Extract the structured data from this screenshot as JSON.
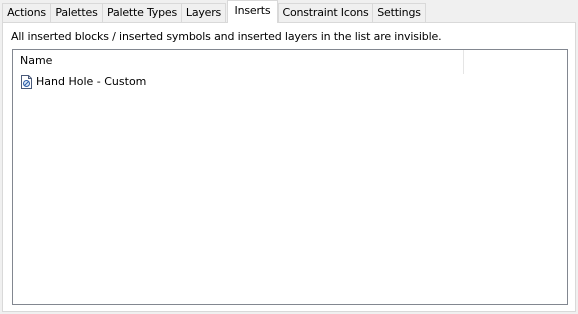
{
  "tabs": [
    {
      "label": "Actions",
      "active": false
    },
    {
      "label": "Palettes",
      "active": false
    },
    {
      "label": "Palette Types",
      "active": false
    },
    {
      "label": "Layers",
      "active": false
    },
    {
      "label": "Inserts",
      "active": true
    },
    {
      "label": "Constraint Icons",
      "active": false
    },
    {
      "label": "Settings",
      "active": false
    }
  ],
  "inserts": {
    "info_text": "All inserted blocks / inserted symbols and inserted layers in the list are invisible.",
    "list": {
      "column_name": "Name",
      "items": [
        {
          "label": "Hand Hole - Custom",
          "icon": "block-insert-icon"
        }
      ]
    }
  }
}
